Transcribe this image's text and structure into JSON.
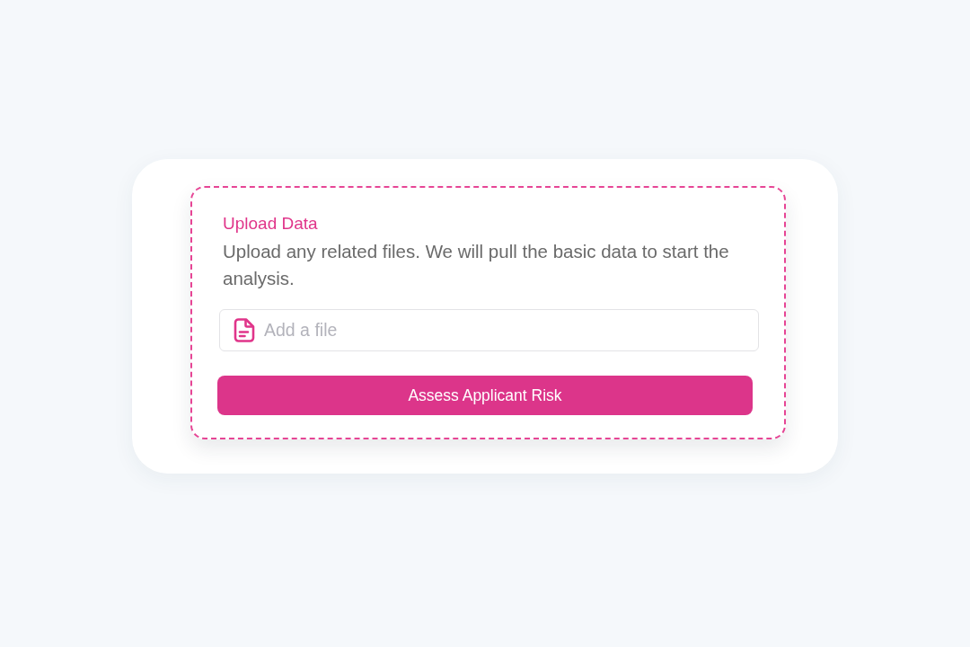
{
  "upload_panel": {
    "title": "Upload Data",
    "description": "Upload any related files. We will pull the basic data to start the analysis.",
    "file_field": {
      "placeholder": "Add a file"
    },
    "submit_button": {
      "label": "Assess Applicant Risk"
    }
  }
}
